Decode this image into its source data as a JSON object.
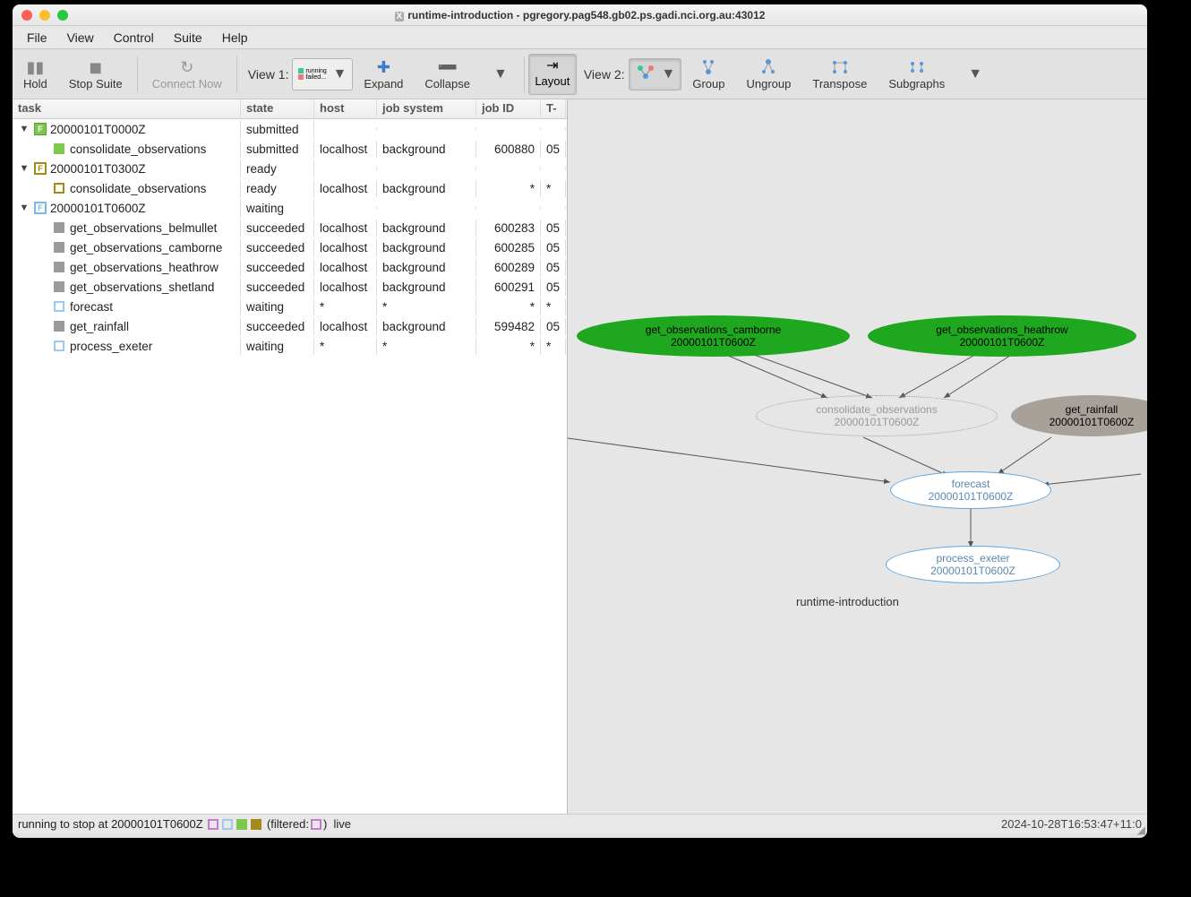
{
  "window": {
    "title": "runtime-introduction - pgregory.pag548.gb02.ps.gadi.nci.org.au:43012"
  },
  "menu": [
    "File",
    "View",
    "Control",
    "Suite",
    "Help"
  ],
  "toolbar": {
    "hold": "Hold",
    "stop": "Stop Suite",
    "connect": "Connect Now",
    "view1": "View 1:",
    "view2": "View 2:",
    "expand": "Expand",
    "collapse": "Collapse",
    "layout": "Layout",
    "group": "Group",
    "ungroup": "Ungroup",
    "transpose": "Transpose",
    "subgraphs": "Subgraphs",
    "legend": {
      "running": "running",
      "failed": "failed..."
    }
  },
  "columns": {
    "task": "task",
    "state": "state",
    "host": "host",
    "js": "job system",
    "jid": "job ID",
    "ts": "T-"
  },
  "rows": [
    {
      "type": "cycle",
      "cycle": "20000101T0000Z",
      "state": "submitted",
      "cb": "cb-g",
      "letter": "F"
    },
    {
      "type": "task",
      "indent": 1,
      "sb": "sb-submitted",
      "name": "consolidate_observations",
      "state": "submitted",
      "host": "localhost",
      "js": "background",
      "jid": "600880",
      "ts": "05"
    },
    {
      "type": "cycle",
      "cycle": "20000101T0300Z",
      "state": "ready",
      "cb": "cb-y",
      "letter": "F"
    },
    {
      "type": "task",
      "indent": 1,
      "sb": "sb-ready",
      "name": "consolidate_observations",
      "state": "ready",
      "host": "localhost",
      "js": "background",
      "jid": "*",
      "ts": "*"
    },
    {
      "type": "cycle",
      "cycle": "20000101T0600Z",
      "state": "waiting",
      "cb": "cb-b",
      "letter": "F"
    },
    {
      "type": "task",
      "indent": 1,
      "sb": "sb-succeeded",
      "name": "get_observations_belmullet",
      "state": "succeeded",
      "host": "localhost",
      "js": "background",
      "jid": "600283",
      "ts": "05"
    },
    {
      "type": "task",
      "indent": 1,
      "sb": "sb-succeeded",
      "name": "get_observations_camborne",
      "state": "succeeded",
      "host": "localhost",
      "js": "background",
      "jid": "600285",
      "ts": "05"
    },
    {
      "type": "task",
      "indent": 1,
      "sb": "sb-succeeded",
      "name": "get_observations_heathrow",
      "state": "succeeded",
      "host": "localhost",
      "js": "background",
      "jid": "600289",
      "ts": "05"
    },
    {
      "type": "task",
      "indent": 1,
      "sb": "sb-succeeded",
      "name": "get_observations_shetland",
      "state": "succeeded",
      "host": "localhost",
      "js": "background",
      "jid": "600291",
      "ts": "05"
    },
    {
      "type": "task",
      "indent": 1,
      "sb": "sb-waiting-task",
      "name": "forecast",
      "state": "waiting",
      "host": "*",
      "js": "*",
      "jid": "*",
      "ts": "*"
    },
    {
      "type": "task",
      "indent": 1,
      "sb": "sb-succeeded",
      "name": "get_rainfall",
      "state": "succeeded",
      "host": "localhost",
      "js": "background",
      "jid": "599482",
      "ts": "05"
    },
    {
      "type": "task",
      "indent": 1,
      "sb": "sb-waiting-task",
      "name": "process_exeter",
      "state": "waiting",
      "host": "*",
      "js": "*",
      "jid": "*",
      "ts": "*"
    }
  ],
  "graph": {
    "label": "runtime-introduction",
    "nodes": {
      "camborne": {
        "l1": "get_observations_camborne",
        "l2": "20000101T0600Z"
      },
      "heathrow": {
        "l1": "get_observations_heathrow",
        "l2": "20000101T0600Z"
      },
      "rainfall": {
        "l1": "get_rainfall",
        "l2": "20000101T0600Z"
      },
      "consolidate": {
        "l1": "consolidate_observations",
        "l2": "20000101T0600Z"
      },
      "forecast": {
        "l1": "forecast",
        "l2": "20000101T0600Z"
      },
      "process": {
        "l1": "process_exeter",
        "l2": "20000101T0600Z"
      }
    }
  },
  "status": {
    "text": "running to stop at 20000101T0600Z",
    "filtered": "(filtered:",
    "close_paren": ")",
    "live": "live",
    "timestamp": "2024-10-28T16:53:47+11:0"
  }
}
